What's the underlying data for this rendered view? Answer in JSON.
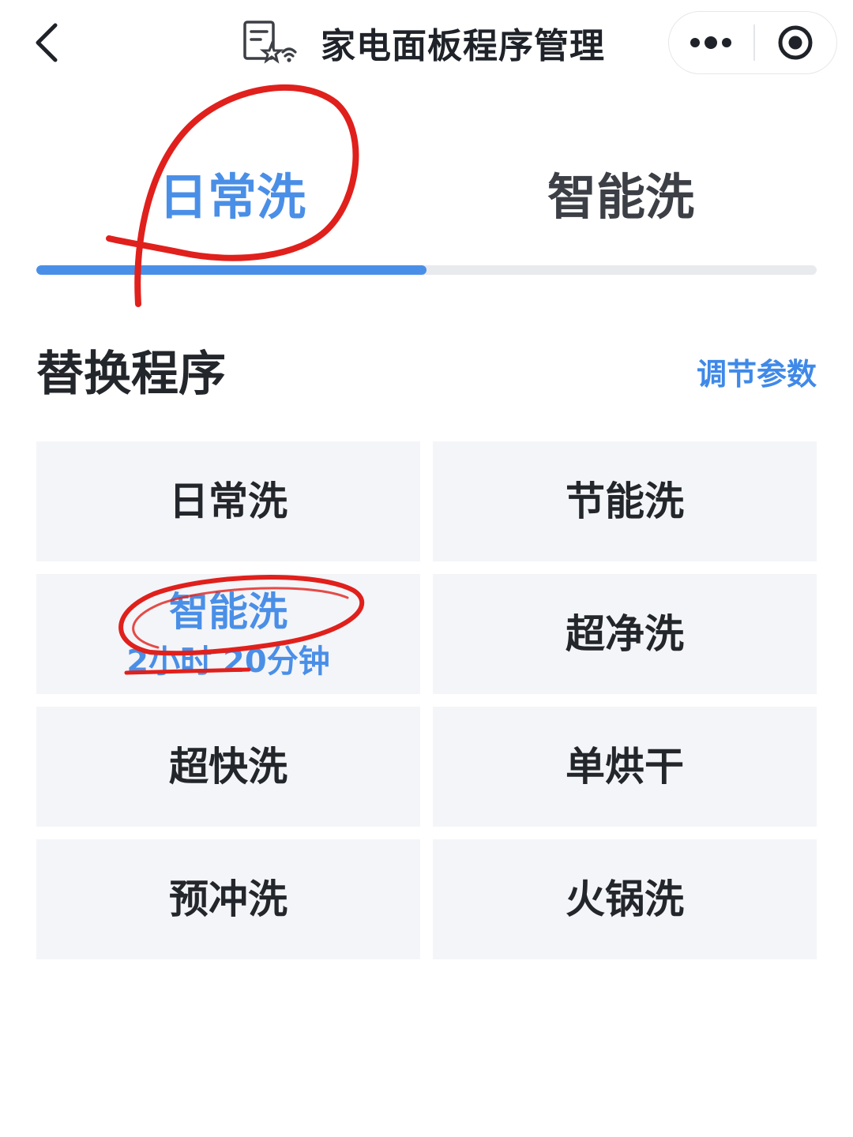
{
  "header": {
    "title": "家电面板程序管理",
    "app_icon": "document-star-wifi-icon",
    "back_icon": "chevron-left-icon",
    "more_icon": "more-dots-icon",
    "close_icon": "target-circle-icon"
  },
  "tabs": [
    {
      "label": "日常洗",
      "active": true
    },
    {
      "label": "智能洗",
      "active": false
    }
  ],
  "tab_progress": 0.5,
  "section": {
    "title": "替换程序",
    "action_label": "调节参数"
  },
  "programs": [
    {
      "label": "日常洗",
      "sub": "",
      "selected": false
    },
    {
      "label": "节能洗",
      "sub": "",
      "selected": false
    },
    {
      "label": "智能洗",
      "sub": "2小时 20分钟",
      "selected": true
    },
    {
      "label": "超净洗",
      "sub": "",
      "selected": false
    },
    {
      "label": "超快洗",
      "sub": "",
      "selected": false
    },
    {
      "label": "单烘干",
      "sub": "",
      "selected": false
    },
    {
      "label": "预冲洗",
      "sub": "",
      "selected": false
    },
    {
      "label": "火锅洗",
      "sub": "",
      "selected": false
    }
  ],
  "colors": {
    "accent": "#4a8fe7",
    "annotation": "#e0201c",
    "cell_bg": "#f4f5f8",
    "text": "#23262b"
  }
}
